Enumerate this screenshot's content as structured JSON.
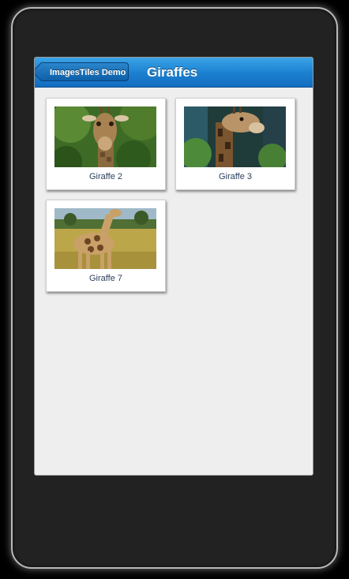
{
  "navbar": {
    "back_label": "ImagesTiles Demo",
    "title": "Giraffes"
  },
  "tiles": [
    {
      "caption": "Giraffe 2"
    },
    {
      "caption": "Giraffe 3"
    },
    {
      "caption": "Giraffe 7"
    }
  ],
  "colors": {
    "navbar_blue": "#1b7fd0",
    "content_bg": "#eeeeee",
    "caption_text": "#2a3f5c"
  }
}
